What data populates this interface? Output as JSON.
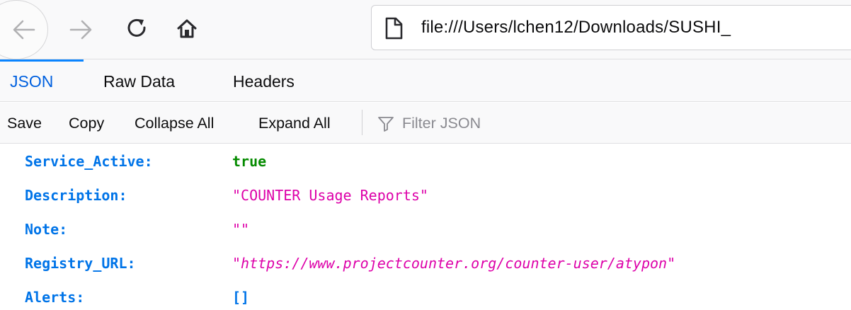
{
  "browser": {
    "url": "file:///Users/lchen12/Downloads/SUSHI_"
  },
  "viewer_tabs": [
    {
      "label": "JSON",
      "selected": true
    },
    {
      "label": "Raw Data",
      "selected": false
    },
    {
      "label": "Headers",
      "selected": false
    }
  ],
  "actions": {
    "save": "Save",
    "copy": "Copy",
    "collapse_all": "Collapse All",
    "expand_all": "Expand All",
    "filter_placeholder": "Filter JSON"
  },
  "json_rows": [
    {
      "key": "Service_Active:",
      "value": "true",
      "type": "boolean"
    },
    {
      "key": "Description:",
      "value": "\"COUNTER Usage Reports\"",
      "type": "string"
    },
    {
      "key": "Note:",
      "value": "\"\"",
      "type": "string"
    },
    {
      "key": "Registry_URL:",
      "value": "https://www.projectcounter.org/counter-user/atypon",
      "type": "url"
    },
    {
      "key": "Alerts:",
      "value": "[]",
      "type": "array"
    }
  ],
  "colors": {
    "key": "#0074e8",
    "boolean": "#058b00",
    "string": "#dd00a9",
    "selected_tab": "#0060df",
    "tab_indicator": "#0a84ff"
  },
  "icons": [
    "back-arrow-icon",
    "forward-arrow-icon",
    "reload-icon",
    "home-icon",
    "page-icon",
    "filter-icon"
  ]
}
